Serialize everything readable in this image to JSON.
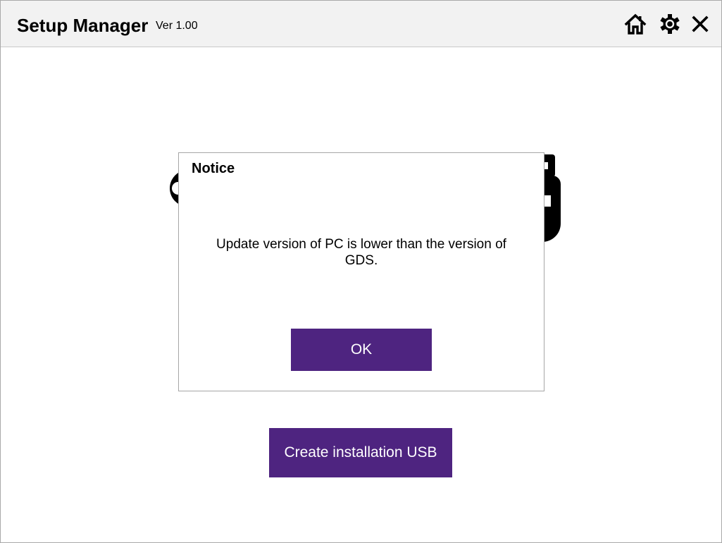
{
  "app": {
    "title": "Setup Manager",
    "version": "Ver 1.00"
  },
  "toolbar": {
    "icons": [
      "home-icon",
      "gear-icon",
      "close-icon"
    ]
  },
  "main": {
    "illustration_icon": "usb-drive-icon",
    "create_usb_label": "Create installation USB"
  },
  "dialog": {
    "title": "Notice",
    "message": "Update version of PC is lower than the version of GDS.",
    "ok_label": "OK"
  },
  "colors": {
    "accent": "#4e2480",
    "titlebar_bg": "#f2f2f2"
  }
}
